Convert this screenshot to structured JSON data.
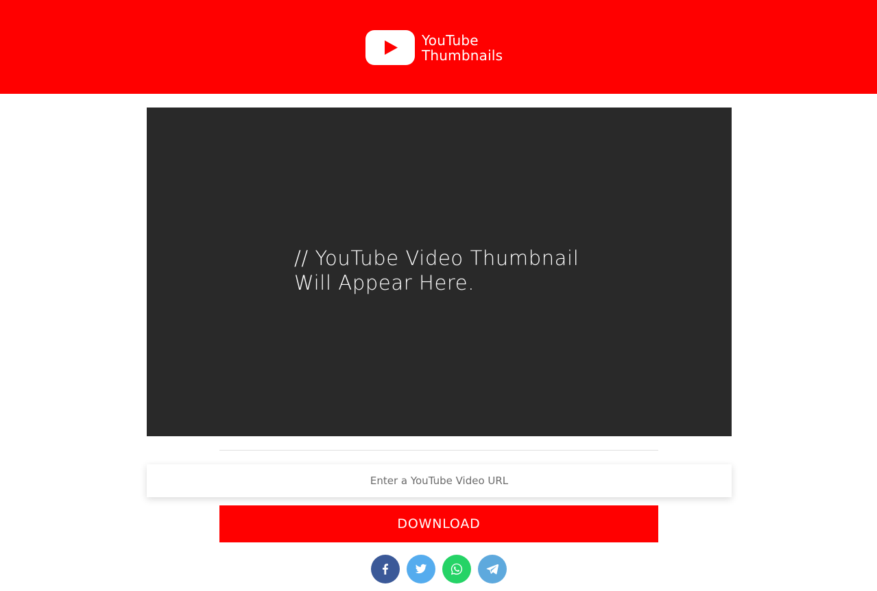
{
  "header": {
    "logo_line1": "YouTube",
    "logo_line2": "Thumbnails",
    "background_color": "#ff0000",
    "logo_icon": "play-button-icon"
  },
  "preview": {
    "placeholder_line1": "// YouTube Video Thumbnail",
    "placeholder_line2": "Will Appear Here.",
    "background_color": "#292929"
  },
  "form": {
    "url_placeholder": "Enter a YouTube Video URL",
    "url_value": "",
    "download_label": "DOWNLOAD",
    "download_color": "#ff0000"
  },
  "share": {
    "buttons": [
      {
        "name": "facebook",
        "icon": "facebook-icon",
        "color": "#3b5998"
      },
      {
        "name": "twitter",
        "icon": "twitter-icon",
        "color": "#55acee"
      },
      {
        "name": "whatsapp",
        "icon": "whatsapp-icon",
        "color": "#25d366"
      },
      {
        "name": "telegram",
        "icon": "telegram-icon",
        "color": "#5ea9dd"
      }
    ]
  }
}
